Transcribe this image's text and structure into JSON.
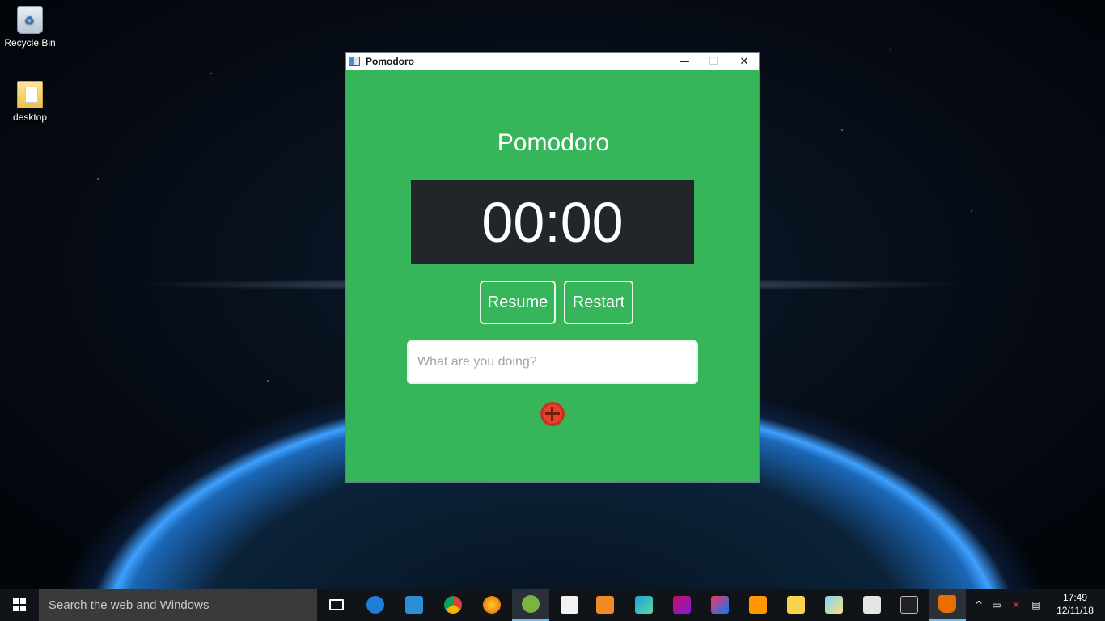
{
  "desktop": {
    "icons": [
      {
        "label": "Recycle Bin",
        "icon": "recycle-bin-icon"
      },
      {
        "label": "desktop",
        "icon": "folder-icon"
      }
    ]
  },
  "window": {
    "title": "Pomodoro",
    "controls": {
      "minimize": "—",
      "maximize": "☐",
      "close": "✕"
    },
    "heading": "Pomodoro",
    "timer": "00:00",
    "buttons": {
      "resume": "Resume",
      "restart": "Restart"
    },
    "task_input": {
      "value": "",
      "placeholder": "What are you doing?"
    },
    "colors": {
      "background": "#37b55b",
      "timer_bg": "#22252a"
    }
  },
  "taskbar": {
    "search_placeholder": "Search the web and Windows",
    "pinned": [
      "task-view-icon",
      "edge-icon",
      "vscode-icon",
      "chrome-icon",
      "firefox-icon",
      "android-studio-icon",
      "video-editor-icon",
      "media-player-icon",
      "webstorm-icon",
      "rider-icon",
      "intellij-icon",
      "sublime-text-icon",
      "file-explorer-icon",
      "photos-icon",
      "calculator-icon",
      "command-prompt-icon",
      "java-icon"
    ],
    "clock": {
      "time": "17:49",
      "date": "12/11/18"
    }
  }
}
